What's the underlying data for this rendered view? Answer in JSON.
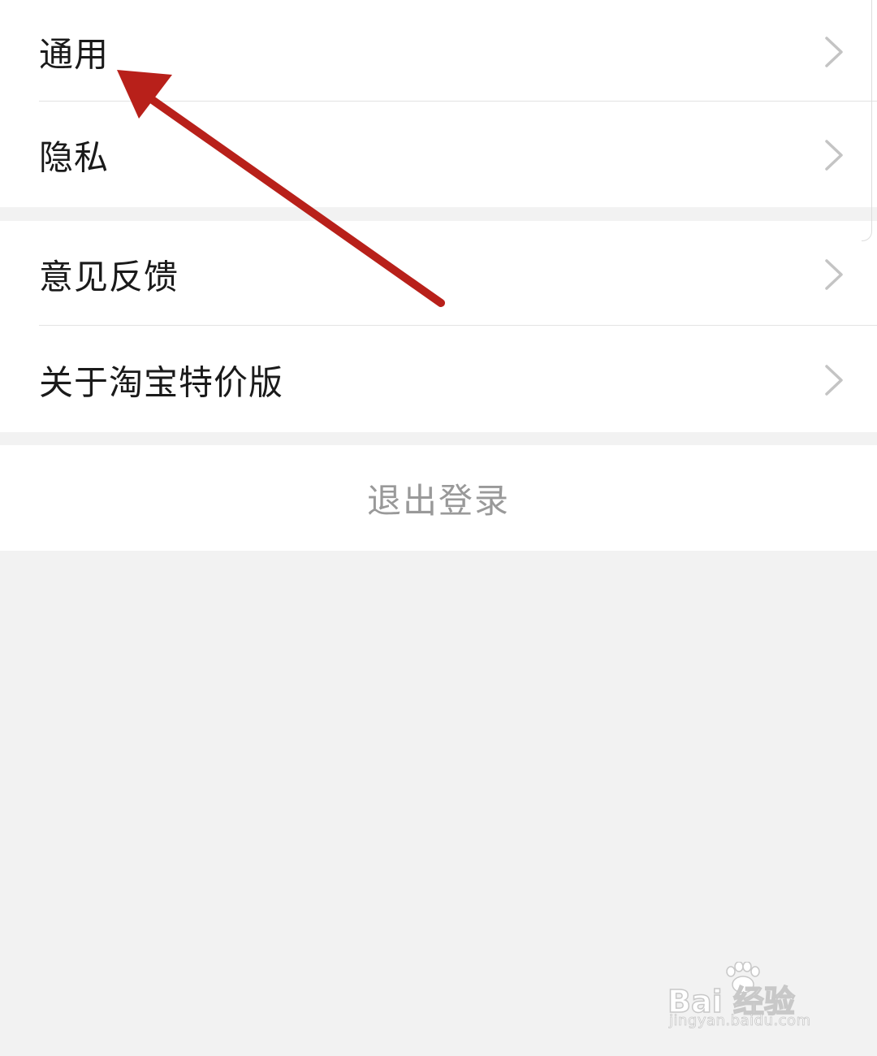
{
  "settings": {
    "group1": [
      {
        "label": "通用"
      },
      {
        "label": "隐私"
      }
    ],
    "group2": [
      {
        "label": "意见反馈"
      },
      {
        "label": "关于淘宝特价版"
      }
    ],
    "logout_label": "退出登录"
  },
  "watermark": {
    "brand": "Bai  经验",
    "url": "jingyan.baidu.com"
  },
  "colors": {
    "background": "#f2f2f2",
    "row": "#ffffff",
    "text": "#1a1a1a",
    "muted": "#999999",
    "chevron": "#c4c4c4",
    "annotation_arrow": "#b8201a"
  },
  "icons": {
    "row_chevron": "chevron-right-icon",
    "annotation": "arrow-annotation-icon",
    "watermark_logo": "paw-logo-icon"
  }
}
